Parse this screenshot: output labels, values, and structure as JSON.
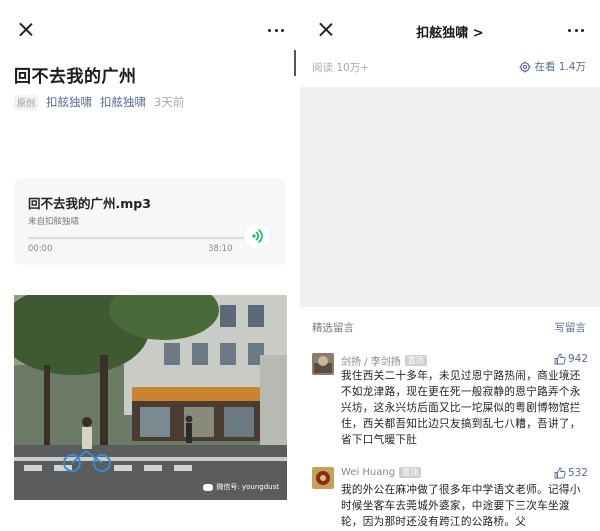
{
  "left": {
    "article_title": "回不去我的广州",
    "original_badge": "原创",
    "author": "扣舷独啸",
    "account": "扣舷独啸",
    "published": "3天前",
    "audio": {
      "title": "回不去我的广州.mp3",
      "source": "来自扣舷独啸",
      "current_time": "00:00",
      "duration": "38:10"
    },
    "photo_watermark": "微信号: youngdust"
  },
  "right": {
    "account_title": "扣舷独啸 >",
    "reads": "阅读 10万+",
    "viewing": "在看 1.4万",
    "comments_label": "精选留言",
    "write_comment": "写留言",
    "comments": [
      {
        "name": "剑扬 / 李剑扬",
        "badge": "置顶",
        "likes": "942",
        "text": "我住西关二十多年，未见过恩宁路热闹，商业境还不如龙津路，现在更在死一般寂静的恩宁路弄个永兴坊，这永兴坊后面又比一坨屎似的粤剧博物馆拦住，西关都吾知比边只友搞到乱七八糟，吾讲了，省下口气暖下肚"
      },
      {
        "name": "Wei Huang",
        "badge": "置顶",
        "likes": "532",
        "text": "我的外公在麻冲做了很多年中学语文老师。记得小时候坐客车去莞城外婆家，中途要下三次车坐渡轮，因为那时还没有跨江的公路桥。父"
      }
    ]
  },
  "colors": {
    "link": "#576b95",
    "panel_gray": "#f0f0f0",
    "play_green": "#07c160"
  }
}
